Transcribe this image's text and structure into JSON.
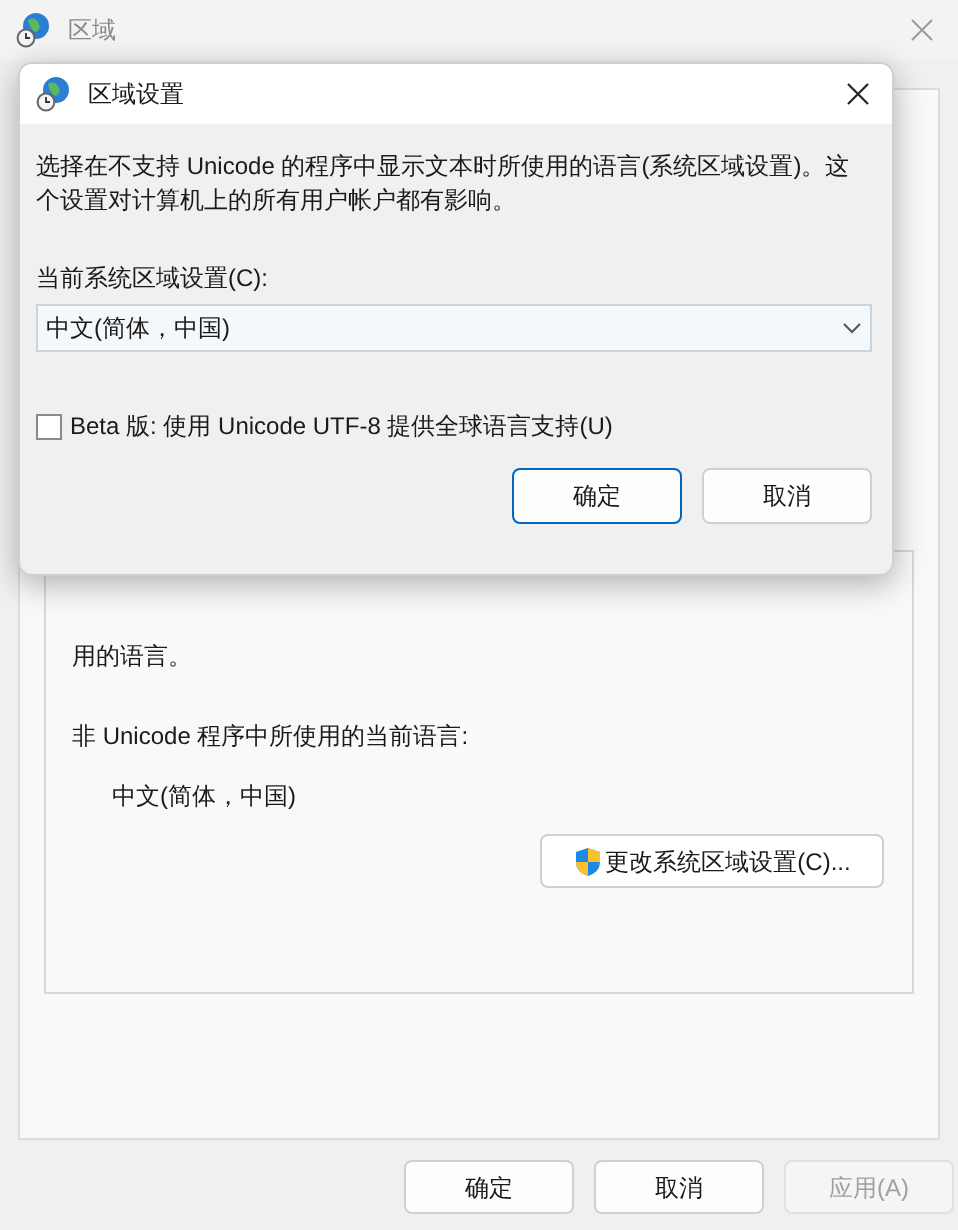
{
  "window": {
    "title": "区域",
    "language_group": {
      "partial_text": "用的语言。",
      "current_label": "非 Unicode 程序中所使用的当前语言:",
      "current_value": "中文(简体，中国)",
      "change_button": "更改系统区域设置(C)..."
    },
    "buttons": [
      {
        "label": "确定",
        "disabled": false
      },
      {
        "label": "取消",
        "disabled": false
      },
      {
        "label": "应用(A)",
        "disabled": true
      }
    ]
  },
  "dialog": {
    "title": "区域设置",
    "description": "选择在不支持 Unicode 的程序中显示文本时所使用的语言(系统区域设置)。这个设置对计算机上的所有用户帐户都有影响。",
    "locale_label": "当前系统区域设置(C):",
    "locale_value": "中文(简体，中国)",
    "beta_checkbox": {
      "label": "Beta 版: 使用 Unicode UTF-8 提供全球语言支持(U)",
      "checked": false
    },
    "buttons": [
      {
        "label": "确定",
        "primary": true
      },
      {
        "label": "取消",
        "primary": false
      }
    ]
  }
}
